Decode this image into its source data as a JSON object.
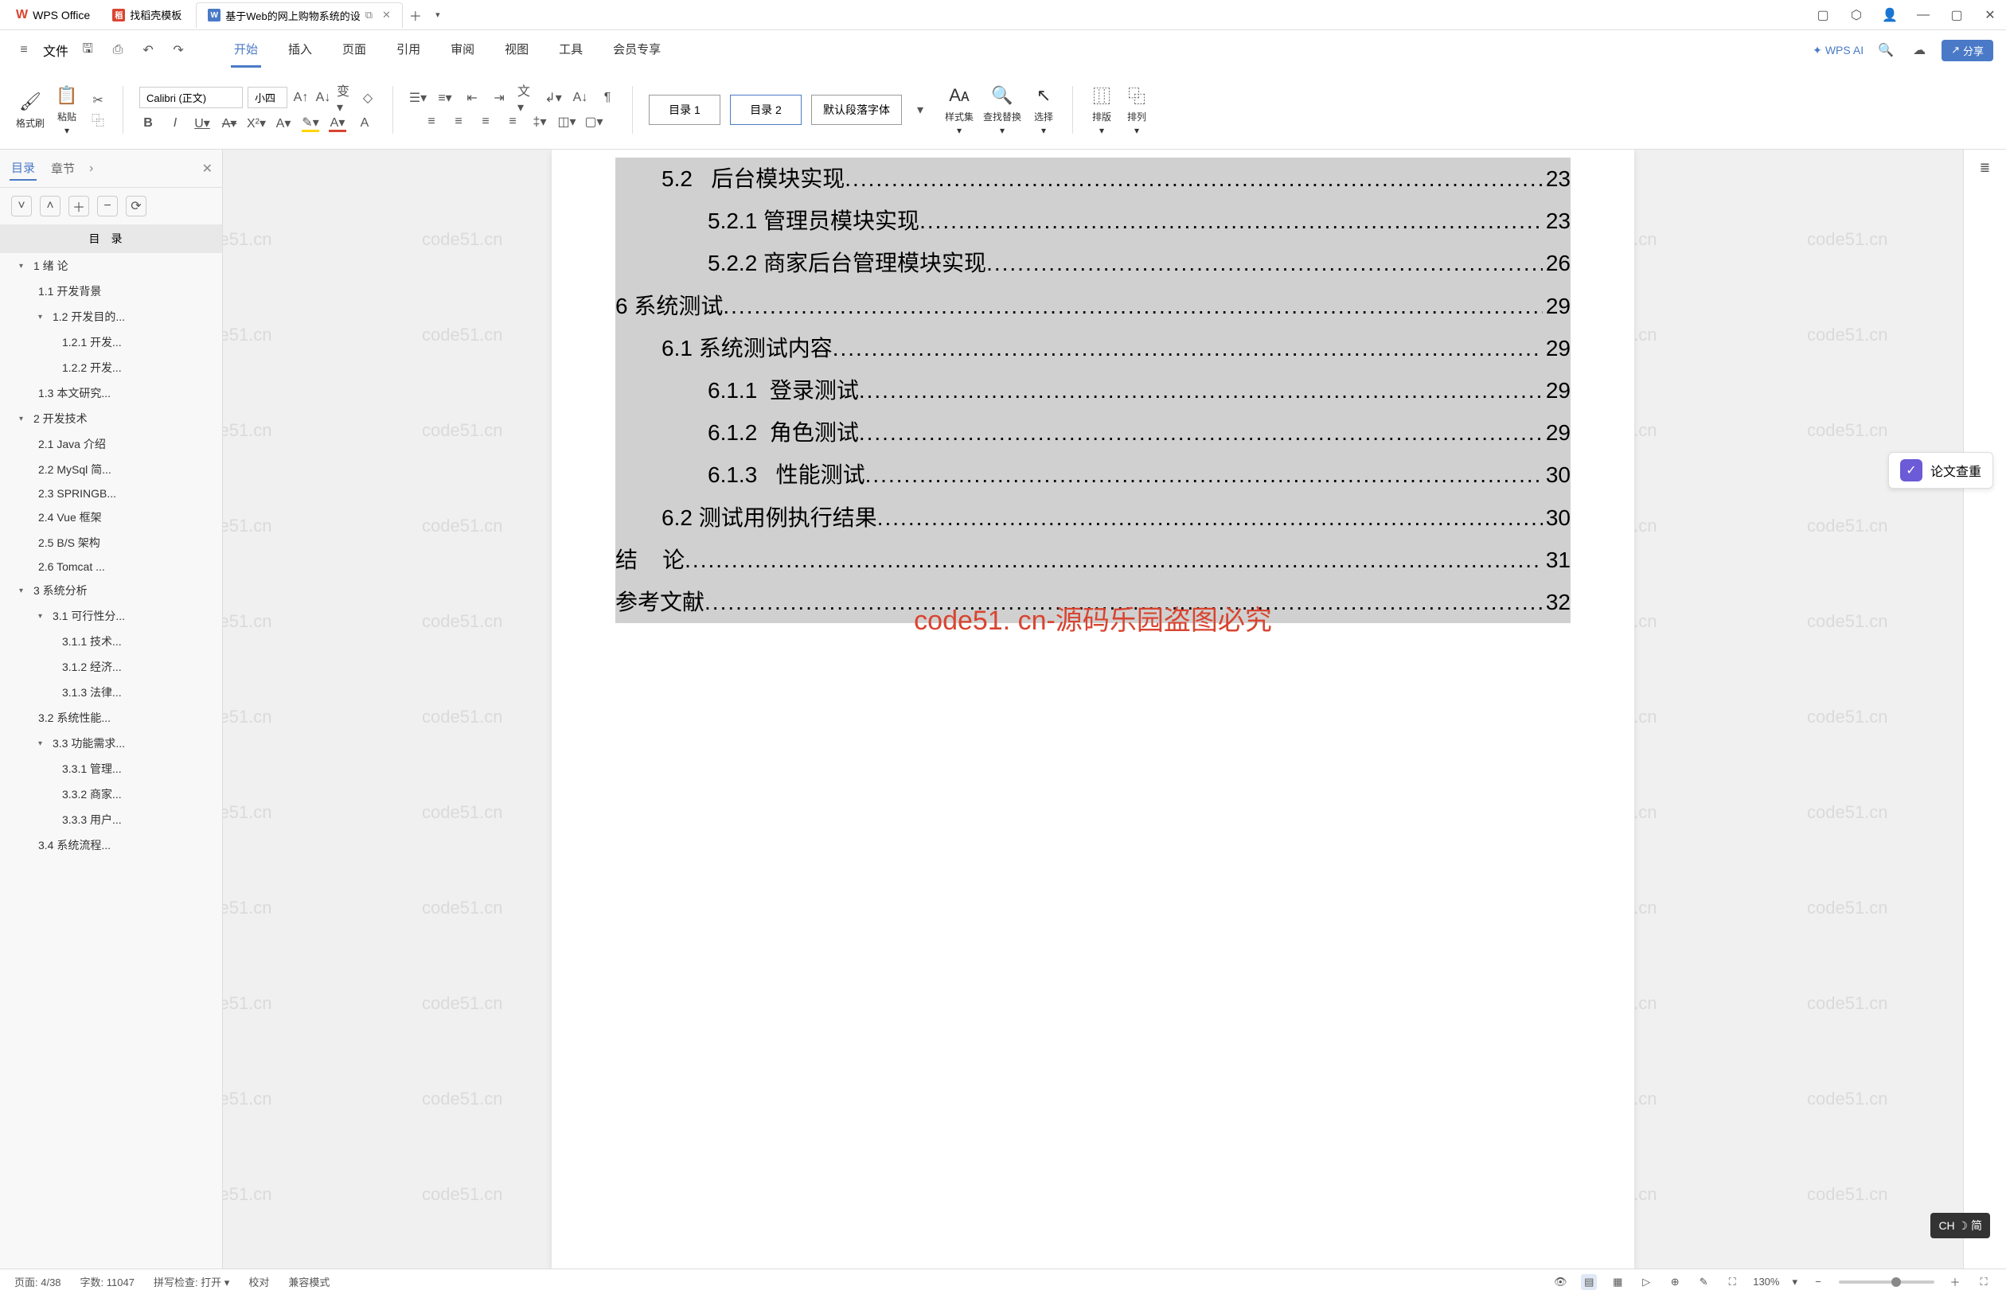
{
  "app": {
    "name": "WPS Office"
  },
  "tabs": [
    {
      "label": "找稻壳模板",
      "icon": "red"
    },
    {
      "label": "基于Web的网上购物系统的设",
      "icon": "blue",
      "active": true
    }
  ],
  "menu": {
    "file": "文件",
    "tabs": [
      "开始",
      "插入",
      "页面",
      "引用",
      "审阅",
      "视图",
      "工具",
      "会员专享"
    ],
    "active": "开始",
    "wps_ai": "WPS AI",
    "share": "分享"
  },
  "toolbar": {
    "format_brush": "格式刷",
    "paste": "粘贴",
    "font": "Calibri (正文)",
    "size": "小四",
    "toc1": "目录 1",
    "toc2": "目录 2",
    "para_font": "默认段落字体",
    "styles": "样式集",
    "find_replace": "查找替换",
    "select": "选择",
    "layout": "排版",
    "arrange": "排列"
  },
  "sidebar": {
    "tab_toc": "目录",
    "tab_chapter": "章节",
    "title": "目录",
    "items": [
      {
        "level": 1,
        "text": "1 绪   论",
        "arrow": true
      },
      {
        "level": 2,
        "text": "1.1 开发背景"
      },
      {
        "level": 2,
        "text": "1.2 开发目的...",
        "arrow": true
      },
      {
        "level": 3,
        "text": "1.2.1 开发..."
      },
      {
        "level": 3,
        "text": "1.2.2 开发..."
      },
      {
        "level": 2,
        "text": "1.3 本文研究..."
      },
      {
        "level": 1,
        "text": "2 开发技术",
        "arrow": true
      },
      {
        "level": 2,
        "text": "2.1 Java 介绍"
      },
      {
        "level": 2,
        "text": "2.2 MySql 简..."
      },
      {
        "level": 2,
        "text": "2.3 SPRINGB..."
      },
      {
        "level": 2,
        "text": "2.4 Vue 框架"
      },
      {
        "level": 2,
        "text": "2.5 B/S 架构"
      },
      {
        "level": 2,
        "text": "2.6 Tomcat ..."
      },
      {
        "level": 1,
        "text": "3 系统分析",
        "arrow": true
      },
      {
        "level": 2,
        "text": "3.1 可行性分...",
        "arrow": true
      },
      {
        "level": 3,
        "text": "3.1.1 技术..."
      },
      {
        "level": 3,
        "text": "3.1.2 经济..."
      },
      {
        "level": 3,
        "text": "3.1.3 法律..."
      },
      {
        "level": 2,
        "text": "3.2 系统性能..."
      },
      {
        "level": 2,
        "text": "3.3 功能需求...",
        "arrow": true
      },
      {
        "level": 3,
        "text": "3.3.1 管理..."
      },
      {
        "level": 3,
        "text": "3.3.2 商家..."
      },
      {
        "level": 3,
        "text": "3.3.3 用户..."
      },
      {
        "level": 2,
        "text": "3.4 系统流程..."
      }
    ]
  },
  "document": {
    "toc": [
      {
        "indent": 1,
        "num": "5.2",
        "text": "   后台模块实现",
        "page": "23"
      },
      {
        "indent": 2,
        "num": "5.2.1",
        "text": " 管理员模块实现",
        "page": "23"
      },
      {
        "indent": 2,
        "num": "5.2.2",
        "text": " 商家后台管理模块实现",
        "page": " 26"
      },
      {
        "indent": 0,
        "num": "6",
        "text": " 系统测试",
        "page": " 29"
      },
      {
        "indent": 1,
        "num": "6.1",
        "text": " 系统测试内容",
        "page": "29"
      },
      {
        "indent": 2,
        "num": "6.1.1",
        "text": "  登录测试",
        "page": "29"
      },
      {
        "indent": 2,
        "num": "6.1.2",
        "text": "  角色测试",
        "page": "29"
      },
      {
        "indent": 2,
        "num": "6.1.3",
        "text": "   性能测试",
        "page": "30"
      },
      {
        "indent": 1,
        "num": "6.2",
        "text": " 测试用例执行结果",
        "page": "30"
      },
      {
        "indent": 0,
        "num": "结",
        "text": "    论",
        "page": " 31"
      },
      {
        "indent": 0,
        "num": "参考文献",
        "text": "",
        "page": " 32"
      }
    ],
    "watermark_red": "code51. cn-源码乐园盗图必究"
  },
  "right_panel": {
    "paper_check": "论文查重"
  },
  "statusbar": {
    "page": "页面: 4/38",
    "words": "字数: 11047",
    "spell": "拼写检查: 打开",
    "proof": "校对",
    "compat": "兼容模式",
    "zoom": "130%"
  },
  "ime": "CH ☽ 简",
  "watermark_text": "code51.cn"
}
